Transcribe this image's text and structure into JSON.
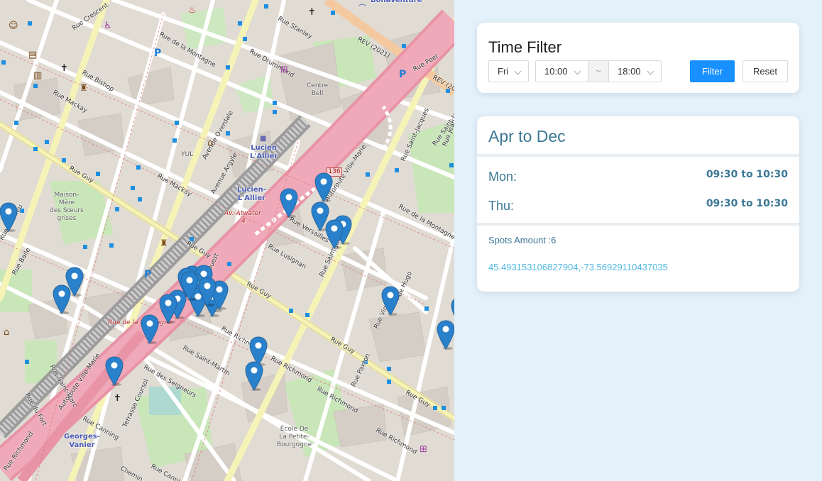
{
  "map": {
    "streets": [
      {
        "text": "Rue Crescent"
      },
      {
        "text": "Rue de la Montagne"
      },
      {
        "text": "Rue Stanley"
      },
      {
        "text": "Rue Drummond"
      },
      {
        "text": "Rue Bishop"
      },
      {
        "text": "Rue Mackay"
      },
      {
        "text": "Rue Guy"
      },
      {
        "text": "Rue Mackay"
      },
      {
        "text": "Avenue Overdale"
      },
      {
        "text": "Avenue Argyle"
      },
      {
        "text": "Rue Mathieu"
      },
      {
        "text": "Rue Baile"
      },
      {
        "text": "Rue Guy"
      },
      {
        "text": "Rue Lusignan"
      },
      {
        "text": "Rue Versailles"
      },
      {
        "text": "Rue Saint-Jacques"
      },
      {
        "text": "Rue Saint-Jacques"
      },
      {
        "text": "Rue de la Montagne"
      },
      {
        "text": "Rue Guy"
      },
      {
        "text": "Rue Richmond"
      },
      {
        "text": "Rue Saint-Martin"
      },
      {
        "text": "Rue des Seigneurs"
      },
      {
        "text": "Rue Richmond"
      },
      {
        "text": "Rue Richmond"
      },
      {
        "text": "Rue Richmond"
      },
      {
        "text": "Rue Guy"
      },
      {
        "text": "Rue Guy"
      },
      {
        "text": "Rue Paxton"
      },
      {
        "text": "Rue Vinet"
      },
      {
        "text": "Rue Peel"
      },
      {
        "text": "Rue Canning"
      },
      {
        "text": "Rue Canning"
      },
      {
        "text": "Terrasse Coursol"
      },
      {
        "text": "Rue du Fort"
      },
      {
        "text": "Rue Saint-Marc"
      },
      {
        "text": "Autoroute Ville-Marie"
      },
      {
        "text": "Autoroute Ville-Marie"
      },
      {
        "text": "Rue Richmond"
      },
      {
        "text": "Rue Saint-Jacques"
      },
      {
        "text": "Rue Jean"
      },
      {
        "text": "Ouest"
      },
      {
        "text": "REV (2021)"
      },
      {
        "text": "REV (202"
      },
      {
        "text": "Rue Hugo"
      },
      {
        "text": "Chemin"
      }
    ],
    "places": [
      {
        "text": "Centre\nBell"
      },
      {
        "text": "Maison-\nMère\ndes Sœurs\ngrises"
      },
      {
        "text": "YUL"
      },
      {
        "text": "École De\nLa Petite-\nBourgogne"
      }
    ],
    "stations": [
      {
        "text": "Lucien\nL'Allier"
      },
      {
        "text": "Lucien-\nL'Allier"
      },
      {
        "text": "Georges-\nVanier"
      },
      {
        "text": "Bonaventure"
      }
    ],
    "red_labels": [
      {
        "text": "Av. Atwater"
      },
      {
        "text": "Rue de la Montagne"
      },
      {
        "text": "4"
      }
    ],
    "route_shield": "136",
    "spot_count": 27
  },
  "filter": {
    "title": "Time Filter",
    "day": "Fri",
    "start_time": "10:00",
    "range_separator": "~",
    "end_time": "18:00",
    "filter_label": "Filter",
    "reset_label": "Reset"
  },
  "schedule": {
    "period": "Apr to Dec",
    "rows": [
      {
        "day": "Mon:",
        "time": "09:30 to 10:30"
      },
      {
        "day": "Thu:",
        "time": "09:30 to 10:30"
      }
    ],
    "spots_amount": "Spots Amount :6",
    "coordinates": "45.493153106827904,-73.56929110437035"
  },
  "colors": {
    "accent": "#1890ff",
    "heading": "#3c7896",
    "link": "#4fb8e0",
    "page_bg": "#e4f1fb",
    "marker": "#2a81cb"
  }
}
